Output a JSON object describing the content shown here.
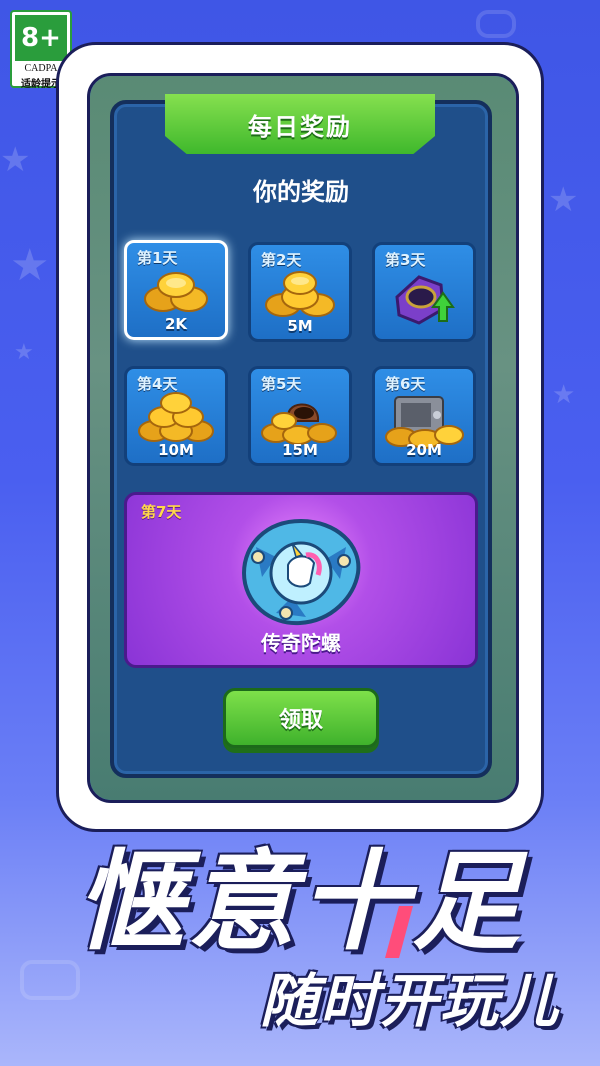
{
  "age_rating": {
    "number": "8+",
    "org": "CADPA",
    "tip": "适龄提示"
  },
  "dialog": {
    "title": "每日奖励",
    "subtitle": "你的奖励"
  },
  "days": [
    {
      "label": "第1天",
      "amount": "2K",
      "icon": "coin-pile-icon",
      "active": true
    },
    {
      "label": "第2天",
      "amount": "5M",
      "icon": "coin-pile-icon",
      "active": false
    },
    {
      "label": "第3天",
      "amount": "",
      "icon": "upgrade-ring-icon",
      "active": false
    },
    {
      "label": "第4天",
      "amount": "10M",
      "icon": "coin-stack-icon",
      "active": false
    },
    {
      "label": "第5天",
      "amount": "15M",
      "icon": "coin-sack-icon",
      "active": false
    },
    {
      "label": "第6天",
      "amount": "20M",
      "icon": "coin-safe-icon",
      "active": false
    }
  ],
  "day7": {
    "label": "第7天",
    "name": "传奇陀螺",
    "icon": "unicorn-spinning-top-icon"
  },
  "claim_button": "领取",
  "slogan": {
    "main": "惬意十足",
    "sub": "随时开玩儿"
  },
  "colors": {
    "background": "#4a5ff0",
    "dialog": "#1f4f8a",
    "card": "#2f8ee6",
    "ribbon": "#3fb82c",
    "day7": "#b24fe8",
    "day7_label": "#ffd84a"
  }
}
